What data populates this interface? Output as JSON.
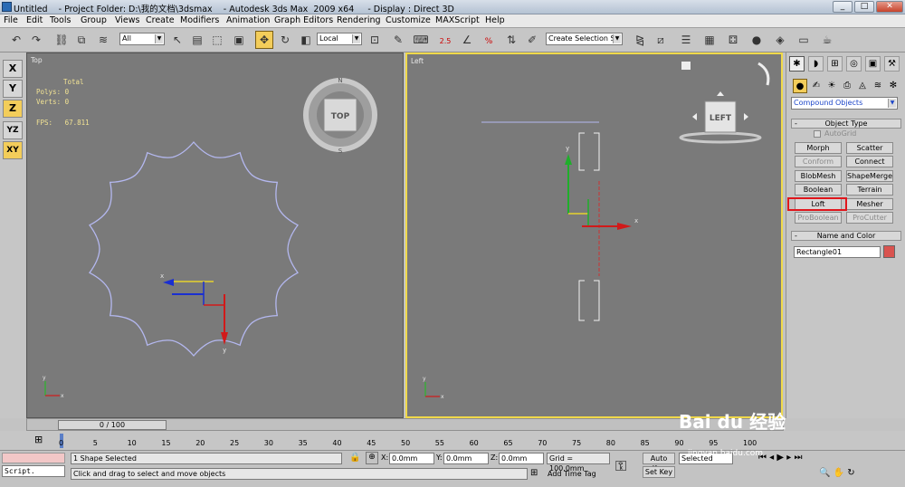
{
  "window": {
    "title": "Untitled    - Project Folder: D:\\我的文档\\3dsmax    - Autodesk 3ds Max  2009 x64     - Display : Direct 3D",
    "buttons": [
      "_",
      "□",
      "✕"
    ]
  },
  "menu": [
    "File",
    "Edit",
    "Tools",
    "Group",
    "Views",
    "Create",
    "Modifiers",
    "Animation",
    "Graph Editors",
    "Rendering",
    "Customize",
    "MAXScript",
    "Help"
  ],
  "toolbar": {
    "filter": "All",
    "refcoord": "Local",
    "selection_set": "Create Selection Se",
    "snap_labels": [
      "2.5",
      "%"
    ]
  },
  "axis_constraints": [
    "X",
    "Y",
    "Z",
    "YZ",
    "XY"
  ],
  "viewport_top": {
    "label": "Top",
    "stats": {
      "total": "Total",
      "polys": "Polys: 0",
      "verts": "Verts: 0",
      "fps": "FPS:   67.811"
    },
    "viewcube": "TOP",
    "compass": [
      "N",
      "S",
      "W",
      "E"
    ],
    "axis": {
      "x": "x",
      "y": "y"
    }
  },
  "viewport_left": {
    "label": "Left",
    "viewcube": "LEFT",
    "axis": {
      "x": "x",
      "y": "y"
    }
  },
  "command_panel": {
    "category": "Compound Objects",
    "object_type_header": "Object Type",
    "autogrid": "AutoGrid",
    "buttons": [
      {
        "label": "Morph",
        "enabled": true
      },
      {
        "label": "Scatter",
        "enabled": true
      },
      {
        "label": "Conform",
        "enabled": false
      },
      {
        "label": "Connect",
        "enabled": true
      },
      {
        "label": "BlobMesh",
        "enabled": true
      },
      {
        "label": "ShapeMerge",
        "enabled": true
      },
      {
        "label": "Boolean",
        "enabled": true
      },
      {
        "label": "Terrain",
        "enabled": true
      },
      {
        "label": "Loft",
        "enabled": true
      },
      {
        "label": "Mesher",
        "enabled": true
      },
      {
        "label": "ProBoolean",
        "enabled": false
      },
      {
        "label": "ProCutter",
        "enabled": false
      }
    ],
    "name_color_header": "Name and Color",
    "object_name": "Rectangle01",
    "object_color": "#d9534f"
  },
  "timeslider": {
    "label": "0 / 100"
  },
  "ruler_ticks": [
    "0",
    "5",
    "10",
    "15",
    "20",
    "25",
    "30",
    "35",
    "40",
    "45",
    "50",
    "55",
    "60",
    "65",
    "70",
    "75",
    "80",
    "85",
    "90",
    "95",
    "100"
  ],
  "status": {
    "selection": "1 Shape Selected",
    "prompt": "Click and drag to select and move objects",
    "x_label": "X:",
    "x_value": "0.0mm",
    "y_label": "Y:",
    "y_value": "0.0mm",
    "z_label": "Z:",
    "z_value": "0.0mm",
    "grid": "Grid = 100.0mm",
    "add_time_tag": "Add Time Tag",
    "auto_key": "Auto Key",
    "set_key": "Set Key",
    "key_filter": "Selected",
    "script": "Script."
  },
  "watermark": {
    "brand": "Bai du 经验",
    "url": "jingyan.baidu.com"
  },
  "colors": {
    "active_button": "#f3cd5a",
    "viewport_bg": "#7a7a7a",
    "active_viewport_border": "#f0d94a",
    "highlight": "#e0161c",
    "shape": "#b4b8f0"
  }
}
